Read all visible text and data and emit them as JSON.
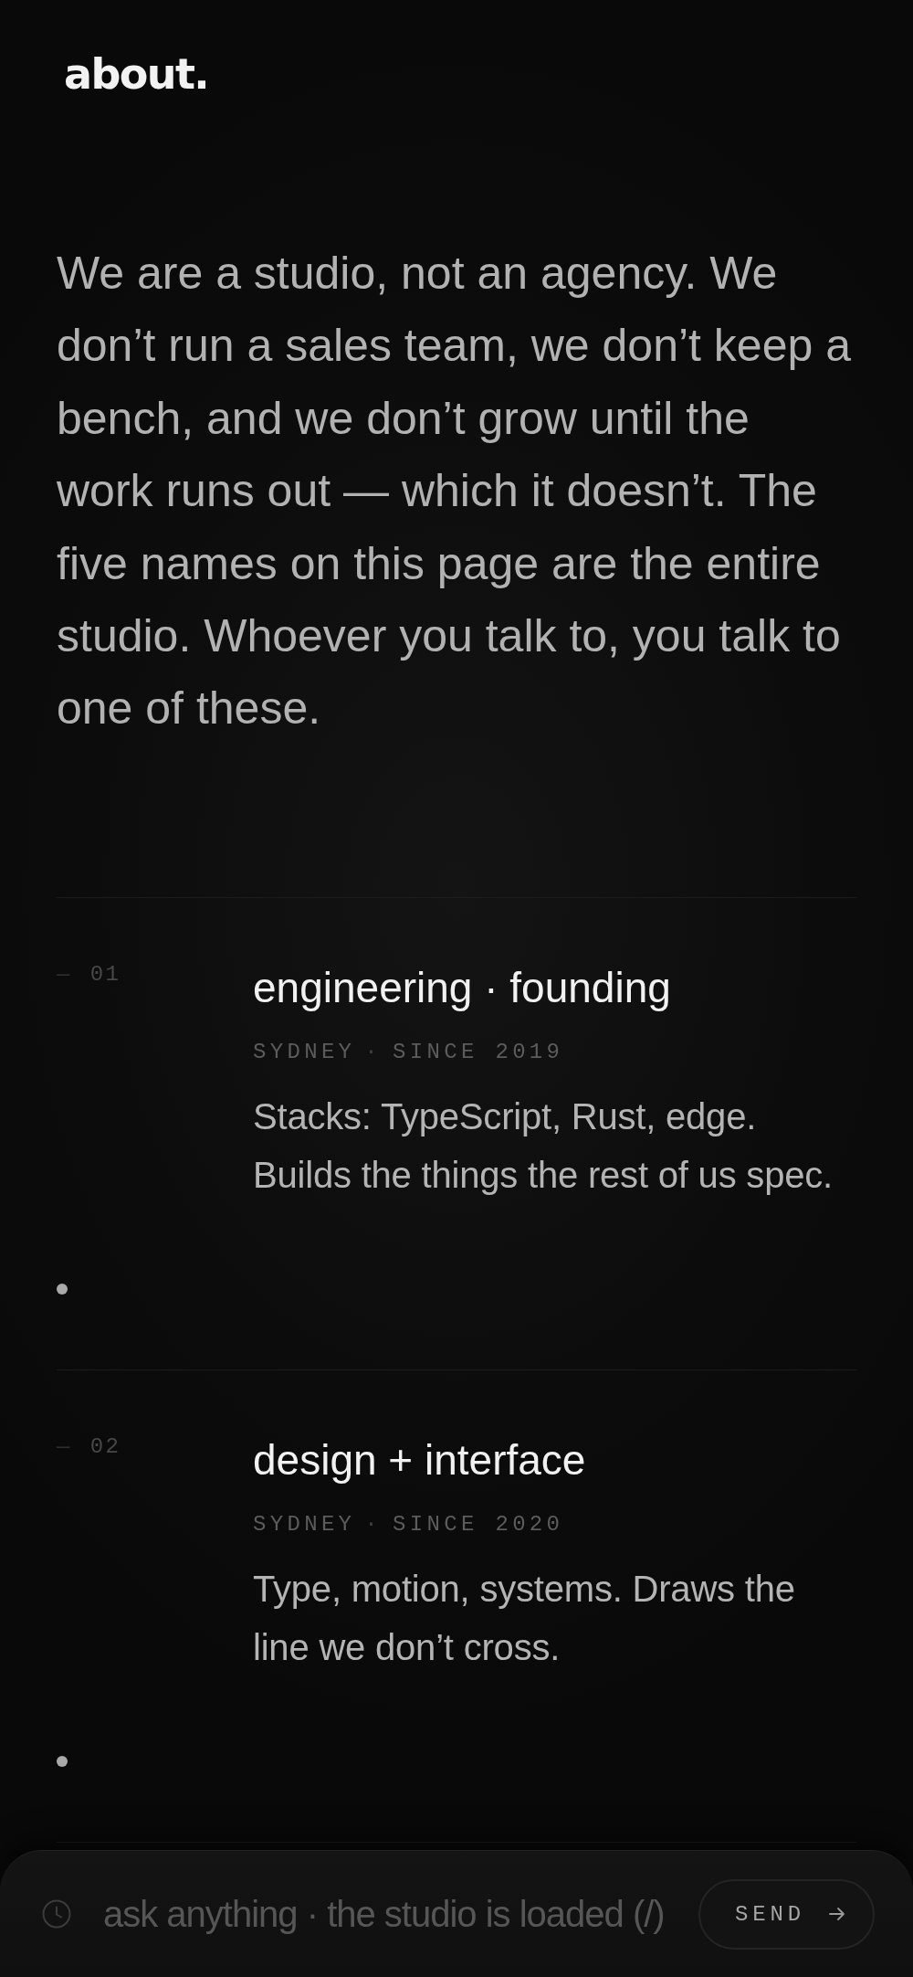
{
  "logo": "about.",
  "intro": "We are a studio, not an agency. We don’t run a sales team, we don’t keep a bench, and we don’t grow until the work runs out — which it doesn’t. The five names on this page are the entire studio. Whoever you talk to, you talk to one of these.",
  "members": [
    {
      "dash": "—",
      "number": "01",
      "role": "engineering · founding",
      "location": "SYDNEY",
      "separator": "·",
      "since": "SINCE 2019",
      "description": "Stacks: TypeScript, Rust, edge. Builds the things the rest of us spec."
    },
    {
      "dash": "—",
      "number": "02",
      "role": "design + interface",
      "location": "SYDNEY",
      "separator": "·",
      "since": "SINCE 2020",
      "description": "Type, motion, systems. Draws the line we don’t cross."
    }
  ],
  "ask_bar": {
    "placeholder": "ask anything · the studio is loaded (/)",
    "button": "SEND"
  }
}
